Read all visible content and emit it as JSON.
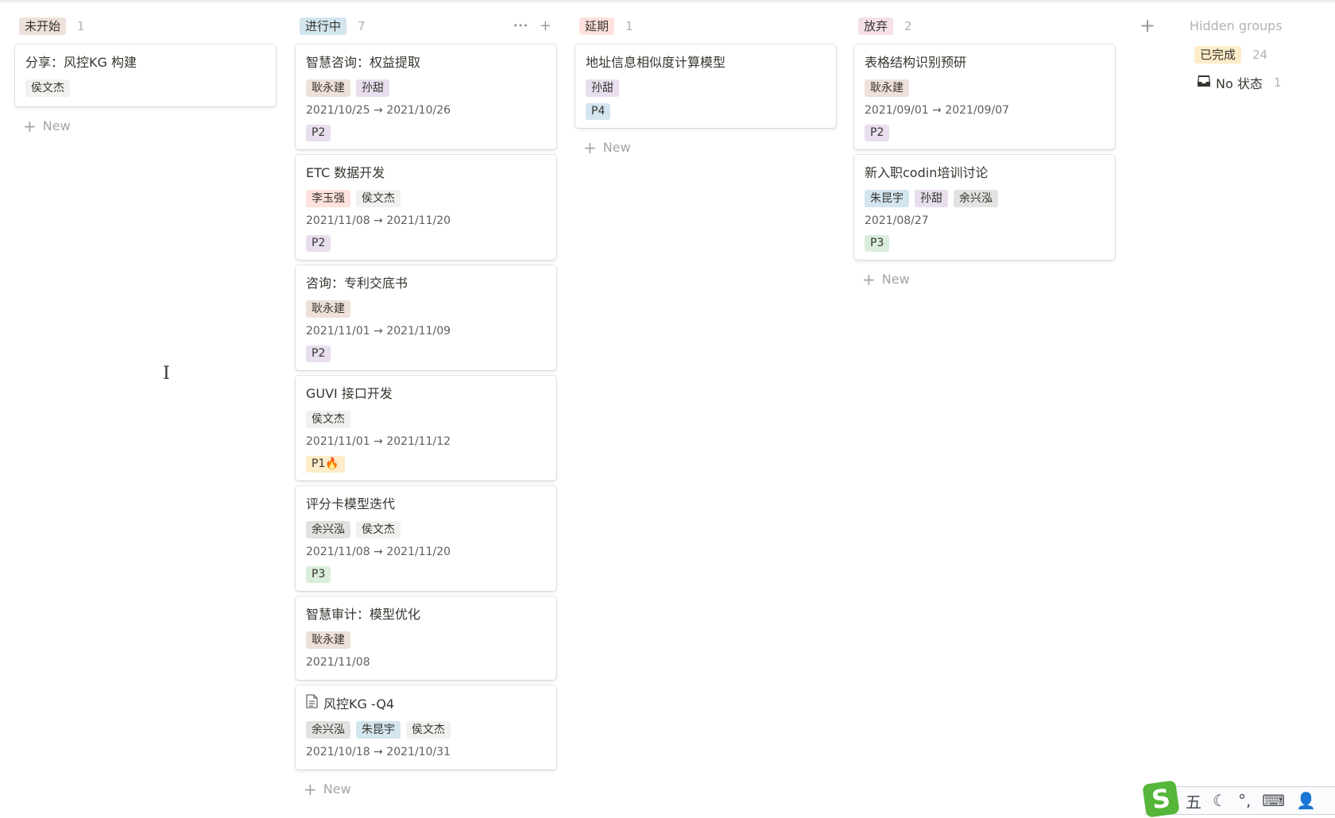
{
  "colors": {
    "brown": "#eee0da",
    "purple": "#e8deee",
    "gray": "#e3e2e0",
    "default": "#f1f1ef",
    "red": "#ffe2dd",
    "blue": "#d3e5ef",
    "green": "#dbeddb",
    "yellow": "#fdecc8",
    "pink": "#f5e0e9"
  },
  "people_colors": {
    "侯文杰": "default",
    "耿永建": "brown",
    "孙甜": "purple",
    "李玉强": "red",
    "余兴泓": "gray",
    "朱昆宇": "blue"
  },
  "priority_colors": {
    "P1🔥": "yellow",
    "P2": "purple",
    "P3": "green",
    "P4": "blue"
  },
  "new_label": "New",
  "columns": [
    {
      "name": "未开始",
      "color": "brown",
      "count": "1",
      "cards": [
        {
          "title": "分享：风控KG 构建",
          "people": [
            "侯文杰"
          ]
        }
      ]
    },
    {
      "name": "进行中",
      "color": "blue",
      "count": "7",
      "actions": true,
      "cards": [
        {
          "title": "智慧咨询：权益提取",
          "people": [
            "耿永建",
            "孙甜"
          ],
          "date": "2021/10/25 → 2021/10/26",
          "priority": "P2"
        },
        {
          "title": "ETC 数据开发",
          "people": [
            "李玉强",
            "侯文杰"
          ],
          "date": "2021/11/08 → 2021/11/20",
          "priority": "P2"
        },
        {
          "title": "咨询：专利交底书",
          "people": [
            "耿永建"
          ],
          "date": "2021/11/01 → 2021/11/09",
          "priority": "P2"
        },
        {
          "title": "GUVI 接口开发",
          "people": [
            "侯文杰"
          ],
          "date": "2021/11/01 → 2021/11/12",
          "priority": "P1🔥"
        },
        {
          "title": "评分卡模型迭代",
          "people": [
            "余兴泓",
            "侯文杰"
          ],
          "date": "2021/11/08 → 2021/11/20",
          "priority": "P3"
        },
        {
          "title": "智慧审计：模型优化",
          "people": [
            "耿永建"
          ],
          "date": "2021/11/08"
        },
        {
          "title": "风控KG -Q4",
          "icon": "document-icon",
          "people": [
            "余兴泓",
            "朱昆宇",
            "侯文杰"
          ],
          "date": "2021/10/18 → 2021/10/31"
        }
      ]
    },
    {
      "name": "延期",
      "color": "red",
      "count": "1",
      "cards": [
        {
          "title": "地址信息相似度计算模型",
          "people": [
            "孙甜"
          ],
          "priority": "P4"
        }
      ]
    },
    {
      "name": "放弃",
      "color": "pink",
      "count": "2",
      "cards": [
        {
          "title": "表格结构识别预研",
          "people": [
            "耿永建"
          ],
          "date": "2021/09/01 → 2021/09/07",
          "priority": "P2"
        },
        {
          "title": "新入职codin培训讨论",
          "people": [
            "朱昆宇",
            "孙甜",
            "余兴泓"
          ],
          "date": "2021/08/27",
          "priority": "P3"
        }
      ]
    }
  ],
  "hidden_groups": {
    "title": "Hidden groups",
    "items": [
      {
        "name": "已完成",
        "count": "24"
      },
      {
        "name": "No 状态",
        "count": "1",
        "icon": "inbox-icon"
      }
    ]
  },
  "ime": {
    "mode": "五",
    "punct": "°,"
  }
}
